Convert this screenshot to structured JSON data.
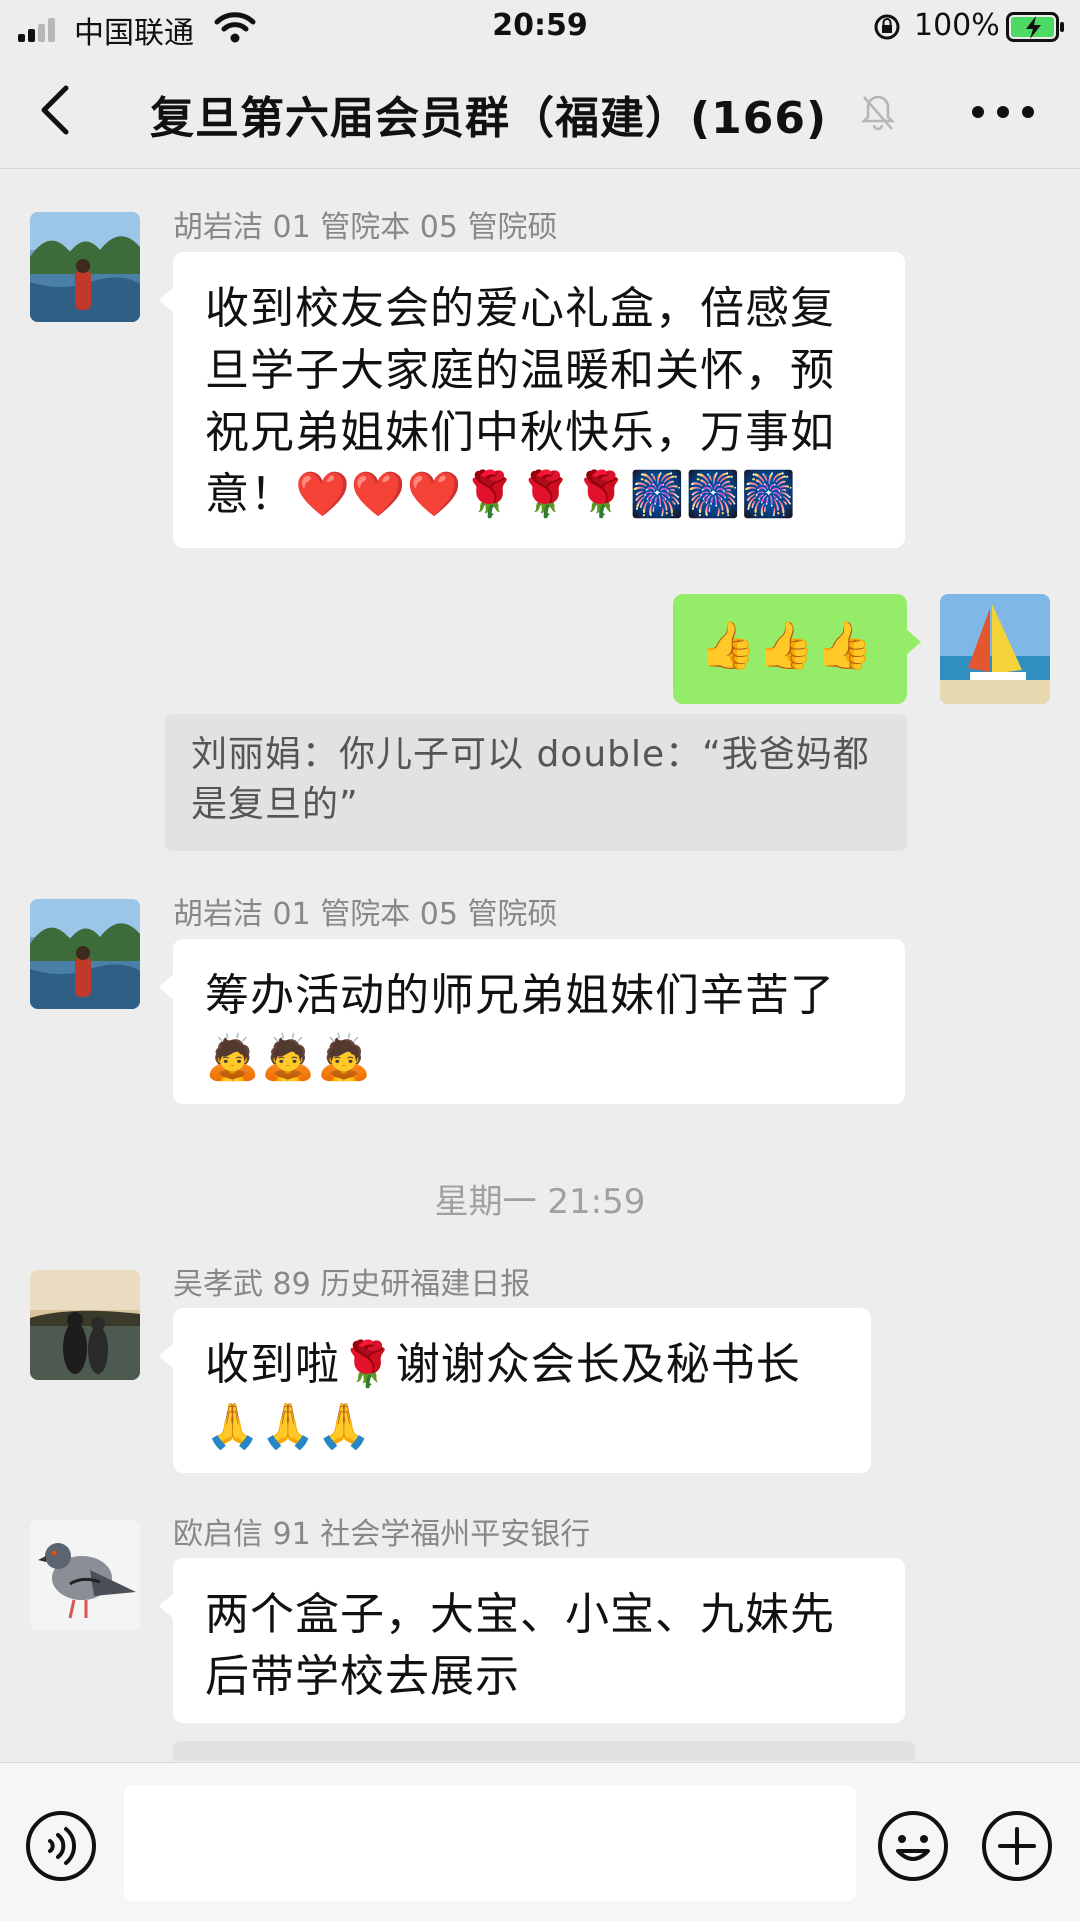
{
  "status_bar": {
    "carrier": "中国联通",
    "time": "20:59",
    "battery_percent": "100%"
  },
  "header": {
    "title": "复旦第六届会员群（福建）(166)",
    "back_icon": "chevron-left-icon",
    "mute_icon": "bell-off-icon",
    "more_icon": "ellipsis-icon"
  },
  "messages": [
    {
      "sender": "胡岩洁 01 管院本 05 管院硕",
      "text": "收到校友会的爱心礼盒，倍感复旦学子大家庭的温暖和关怀，预祝兄弟姐妹们中秋快乐，万事如意！",
      "emoji": "❤️❤️❤️🌹🌹🌹🎆🎆🎆"
    },
    {
      "text": "👍👍👍"
    },
    {
      "quote": "刘丽娟：你儿子可以 double：“我爸妈都是复旦的”"
    },
    {
      "sender": "胡岩洁 01 管院本 05 管院硕",
      "text": "筹办活动的师兄弟姐妹们辛苦了",
      "emoji": "🙇🙇🙇"
    },
    {
      "timestamp": "星期一 21:59"
    },
    {
      "sender": "吴孝武 89 历史研福建日报",
      "text": "收到啦🌹谢谢众会长及秘书长",
      "emoji": "🙏🙏🙏"
    },
    {
      "sender": "欧启信 91 社会学福州平安银行",
      "text": "两个盒子，大宝、小宝、九妹先后带学校去展示"
    }
  ],
  "input_bar": {
    "voice_icon": "voice-icon",
    "emoji_icon": "smile-icon",
    "plus_icon": "plus-icon",
    "input_value": ""
  },
  "colors": {
    "background": "#ededed",
    "my_bubble": "#95ec69",
    "other_bubble": "#ffffff"
  }
}
